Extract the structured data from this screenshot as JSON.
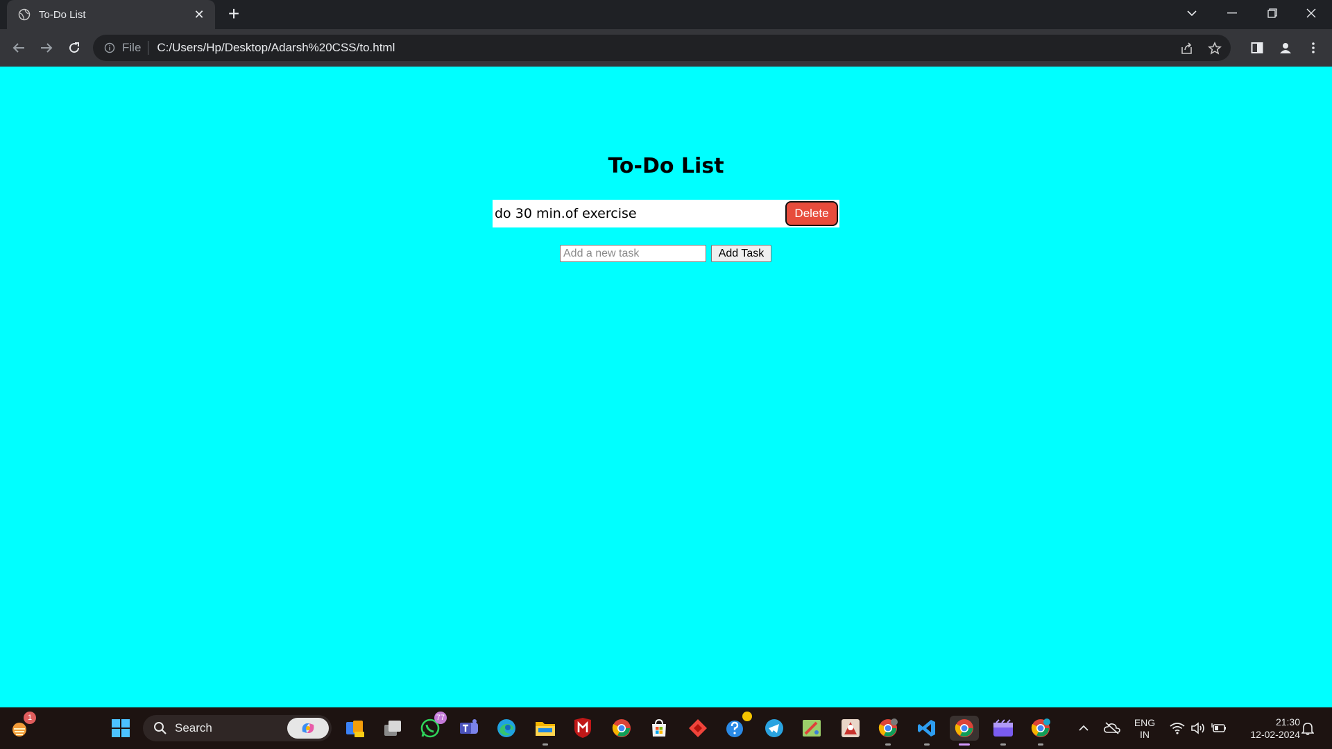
{
  "browser": {
    "tab_title": "To-Do List",
    "address": {
      "scheme": "File",
      "url": "C:/Users/Hp/Desktop/Adarsh%20CSS/to.html"
    }
  },
  "app": {
    "heading": "To-Do List",
    "tasks": [
      {
        "text": "do 30 min.of exercise",
        "delete_label": "Delete"
      }
    ],
    "new_task_placeholder": "Add a new task",
    "add_button_label": "Add Task",
    "colors": {
      "page_background": "#00ffff",
      "delete_button": "#e74c3c"
    }
  },
  "taskbar": {
    "search_label": "Search",
    "badges": {
      "notifications": "1",
      "whatsapp": "77"
    },
    "language": {
      "line1": "ENG",
      "line2": "IN"
    },
    "clock": {
      "time": "21:30",
      "date": "12-02-2024"
    }
  }
}
